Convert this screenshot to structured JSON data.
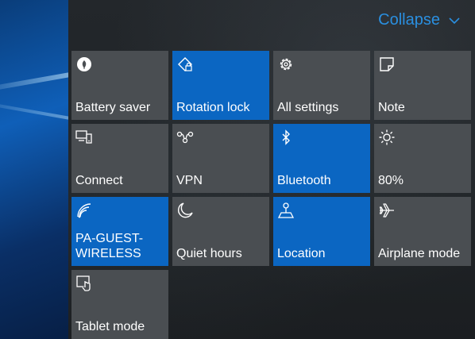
{
  "header": {
    "collapse_label": "Collapse"
  },
  "tiles": [
    {
      "label": "Battery saver",
      "icon": "battery-saver-icon",
      "active": false
    },
    {
      "label": "Rotation lock",
      "icon": "rotation-lock-icon",
      "active": true
    },
    {
      "label": "All settings",
      "icon": "gear-icon",
      "active": false
    },
    {
      "label": "Note",
      "icon": "note-icon",
      "active": false
    },
    {
      "label": "Connect",
      "icon": "connect-icon",
      "active": false
    },
    {
      "label": "VPN",
      "icon": "vpn-icon",
      "active": false
    },
    {
      "label": "Bluetooth",
      "icon": "bluetooth-icon",
      "active": true
    },
    {
      "label": "80%",
      "icon": "brightness-icon",
      "active": false
    },
    {
      "label": "PA-GUEST-\nWIRELESS",
      "icon": "wifi-icon",
      "active": true
    },
    {
      "label": "Quiet hours",
      "icon": "moon-icon",
      "active": false
    },
    {
      "label": "Location",
      "icon": "location-icon",
      "active": true
    },
    {
      "label": "Airplane mode",
      "icon": "airplane-icon",
      "active": false
    },
    {
      "label": "Tablet mode",
      "icon": "tablet-mode-icon",
      "active": false
    }
  ],
  "colors": {
    "accent": "#0b66c2",
    "tile_off": "#4a4e52",
    "link": "#2a8fe0"
  }
}
